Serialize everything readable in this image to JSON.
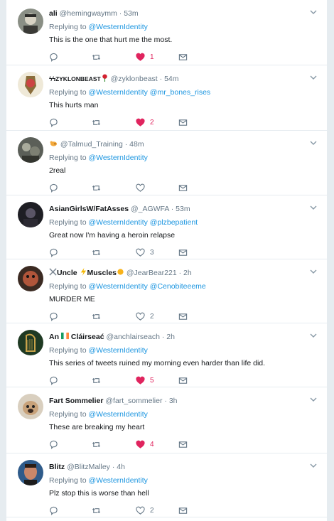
{
  "replying_label": "Replying to",
  "tweets": [
    {
      "fullname": "ali",
      "handle": "@hemingwaymm",
      "dot": "·",
      "time": "53m",
      "mentions": [
        "@WesternIdentity"
      ],
      "text": "This is the one that hurt me the most.",
      "reply_count": "",
      "retweet_count": "",
      "like_count": "1",
      "liked": true
    },
    {
      "fullname": "ZYKLONBEAST",
      "handle": "@zyklonbeast",
      "dot": "·",
      "time": "54m",
      "mentions": [
        "@WesternIdentity",
        "@mr_bones_rises"
      ],
      "text": "This hurts man",
      "reply_count": "",
      "retweet_count": "",
      "like_count": "2",
      "liked": true
    },
    {
      "fullname": "",
      "handle": "@Talmud_Training",
      "dot": "·",
      "time": "48m",
      "mentions": [
        "@WesternIdentity"
      ],
      "text": "2real",
      "reply_count": "",
      "retweet_count": "",
      "like_count": "",
      "liked": false
    },
    {
      "fullname": "AsianGirlsW/FatAsses",
      "handle": "@_AGWFA",
      "dot": "·",
      "time": "53m",
      "mentions": [
        "@WesternIdentity",
        "@plzbepatient"
      ],
      "text": "Great now I'm having a heroin relapse",
      "reply_count": "",
      "retweet_count": "",
      "like_count": "3",
      "liked": false
    },
    {
      "fullname": "Uncle",
      "fullname_2": "Muscles",
      "handle": "@JearBear221",
      "dot": "·",
      "time": "2h",
      "mentions": [
        "@WesternIdentity",
        "@Cenobiteeeme"
      ],
      "text": "MURDER ME",
      "reply_count": "",
      "retweet_count": "",
      "like_count": "2",
      "liked": false
    },
    {
      "fullname": "An",
      "fullname_2": "Cláirseać",
      "handle": "@anchlairseach",
      "dot": "·",
      "time": "2h",
      "mentions": [
        "@WesternIdentity"
      ],
      "text": "This series of tweets ruined my morning even harder than life did.",
      "reply_count": "",
      "retweet_count": "",
      "like_count": "5",
      "liked": true
    },
    {
      "fullname": "Fart Sommelier",
      "handle": "@fart_sommelier",
      "dot": "·",
      "time": "3h",
      "mentions": [
        "@WesternIdentity"
      ],
      "text": "These are breaking my heart",
      "reply_count": "",
      "retweet_count": "",
      "like_count": "4",
      "liked": true
    },
    {
      "fullname": "Blitz",
      "handle": "@BlitzMalley",
      "dot": "·",
      "time": "4h",
      "mentions": [
        "@WesternIdentity"
      ],
      "text": "Plz stop this is worse than hell",
      "reply_count": "",
      "retweet_count": "",
      "like_count": "2",
      "liked": false
    }
  ],
  "colors": {
    "background": "#e6ecf0",
    "card": "#ffffff",
    "text": "#14171a",
    "secondary": "#657786",
    "link": "#1b95e0",
    "like_active": "#e0245e"
  },
  "icons": [
    "reply-icon",
    "retweet-icon",
    "heart-icon",
    "envelope-icon",
    "chevron-down-icon"
  ]
}
